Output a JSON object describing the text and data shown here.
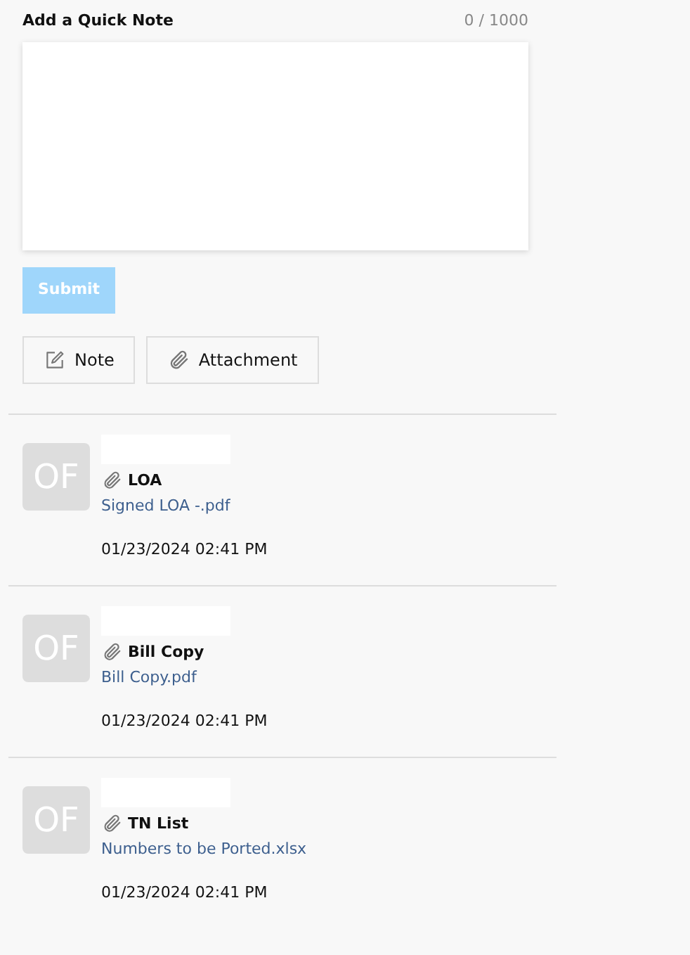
{
  "quick_note": {
    "label": "Add a Quick Note",
    "counter": "0 / 1000",
    "submit": {
      "label": "Submit",
      "disabled": true
    }
  },
  "actions": [
    {
      "kind": "note",
      "label": "Note"
    },
    {
      "kind": "attachment",
      "label": "Attachment"
    }
  ],
  "entries": [
    {
      "initials": "OF",
      "title": "LOA",
      "file": "Signed LOA -.pdf",
      "timestamp": "01/23/2024 02:41 PM"
    },
    {
      "initials": "OF",
      "title": "Bill Copy",
      "file": "Bill Copy.pdf",
      "timestamp": "01/23/2024 02:41 PM"
    },
    {
      "initials": "OF",
      "title": "TN List",
      "file": "Numbers to be Ported.xlsx",
      "timestamp": "01/23/2024 02:41 PM"
    }
  ]
}
